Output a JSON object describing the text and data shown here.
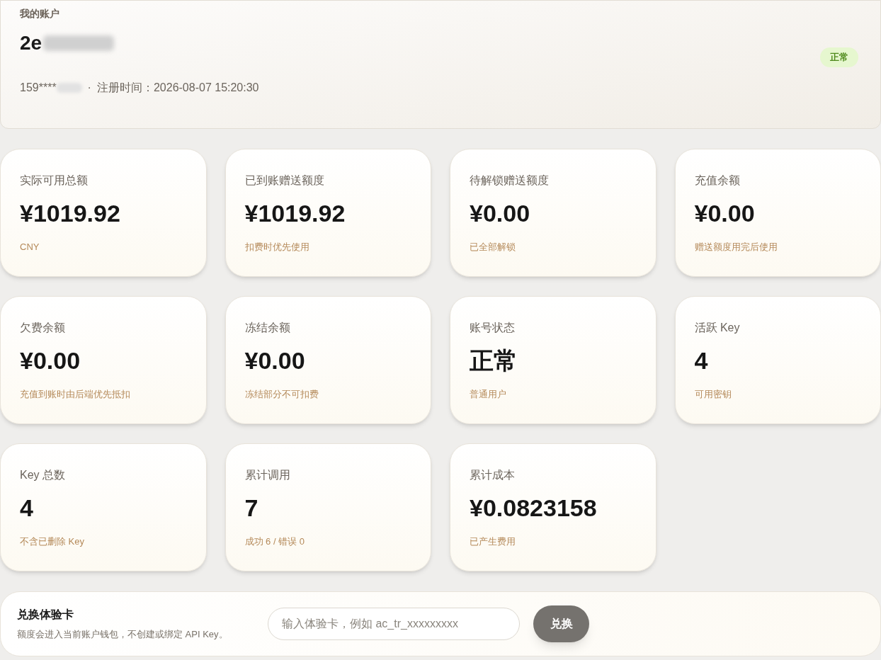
{
  "account": {
    "heading": "我的账户",
    "username": "2e",
    "phone": "159****",
    "separator": "·",
    "registered": "注册时间：2026-08-07 15:20:30",
    "status_badge": "正常"
  },
  "stats": [
    {
      "label": "实际可用总额",
      "value": "¥1019.92",
      "note": "CNY"
    },
    {
      "label": "已到账赠送额度",
      "value": "¥1019.92",
      "note": "扣费时优先使用"
    },
    {
      "label": "待解锁赠送额度",
      "value": "¥0.00",
      "note": "已全部解锁"
    },
    {
      "label": "充值余额",
      "value": "¥0.00",
      "note": "赠送额度用完后使用"
    },
    {
      "label": "欠费余额",
      "value": "¥0.00",
      "note": "充值到账时由后端优先抵扣"
    },
    {
      "label": "冻结余额",
      "value": "¥0.00",
      "note": "冻结部分不可扣费"
    },
    {
      "label": "账号状态",
      "value": "正常",
      "note": "普通用户"
    },
    {
      "label": "活跃 Key",
      "value": "4",
      "note": "可用密钥"
    },
    {
      "label": "Key 总数",
      "value": "4",
      "note": "不含已删除 Key"
    },
    {
      "label": "累计调用",
      "value": "7",
      "note": "成功 6 / 错误 0"
    },
    {
      "label": "累计成本",
      "value": "¥0.0823158",
      "note": "已产生费用"
    }
  ],
  "redeem": {
    "title": "兑换体验卡",
    "description": "额度会进入当前账户钱包，不创建或绑定 API Key。",
    "placeholder": "输入体验卡，例如 ac_tr_xxxxxxxxx",
    "button": "兑换"
  }
}
